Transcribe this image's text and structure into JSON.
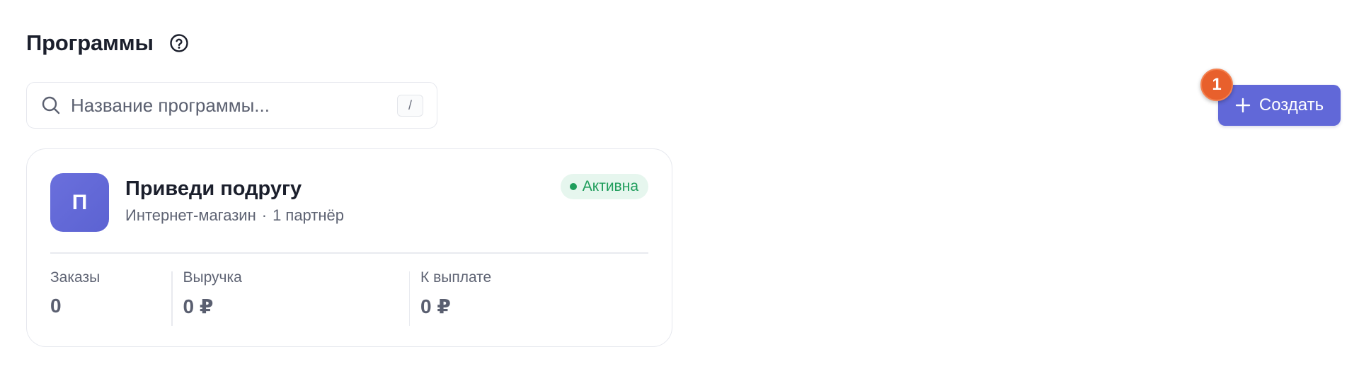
{
  "header": {
    "title": "Программы",
    "help_icon": "help-circle-icon"
  },
  "search": {
    "placeholder": "Название программы...",
    "value": "",
    "shortcut": "/",
    "icon": "search-icon"
  },
  "toolbar": {
    "create_label": "Создать",
    "create_icon": "plus-icon",
    "step_badge": "1"
  },
  "program_card": {
    "avatar_letter": "П",
    "name": "Приведи подругу",
    "type": "Интернет-магазин",
    "separator": "·",
    "partners": "1 партнёр",
    "status": "Активна",
    "stats": [
      {
        "label": "Заказы",
        "value": "0"
      },
      {
        "label": "Выручка",
        "value": "0 ₽"
      },
      {
        "label": "К выплате",
        "value": "0 ₽"
      }
    ]
  },
  "colors": {
    "accent": "#6168d8",
    "badge": "#e8602c",
    "status_green": "#1f9d5c",
    "status_bg": "#e6f6ee"
  }
}
